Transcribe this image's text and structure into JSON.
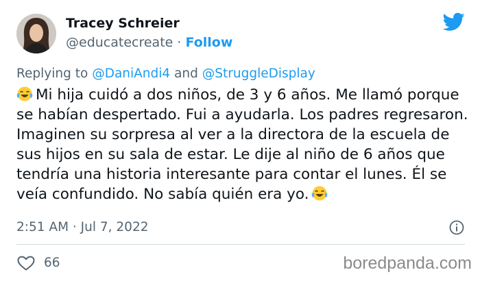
{
  "author": {
    "name": "Tracey Schreier",
    "handle": "@educatecreate",
    "separator": "·",
    "follow_label": "Follow"
  },
  "reply": {
    "prefix": "Replying to",
    "mention1": "@DaniAndi4",
    "connector": "and",
    "mention2": "@StruggleDisplay"
  },
  "tweet": {
    "text": "Mi hija cuidó a dos niños, de 3 y 6 años. Me llamó porque se habían despertado. Fui a ayudarla. Los padres regresaron. Imaginen su sorpresa al ver a la directora de la escuela de sus hijos en su sala de estar. Le dije al niño de 6 años que tendría una historia interesante para contar el lunes. Él se veía confundido. No sabía quién era yo.",
    "leading_emoji": "tears-of-joy-emoji",
    "trailing_emoji": "tears-of-joy-emoji"
  },
  "meta": {
    "timestamp": "2:51 AM · Jul 7, 2022"
  },
  "stats": {
    "likes": "66"
  },
  "watermark": "boredpanda.com",
  "colors": {
    "accent": "#1d9bf0",
    "text": "#0f1419",
    "muted": "#536471",
    "divider": "#cfd9de"
  },
  "icons": [
    "twitter-bird-icon",
    "info-icon",
    "heart-icon"
  ]
}
